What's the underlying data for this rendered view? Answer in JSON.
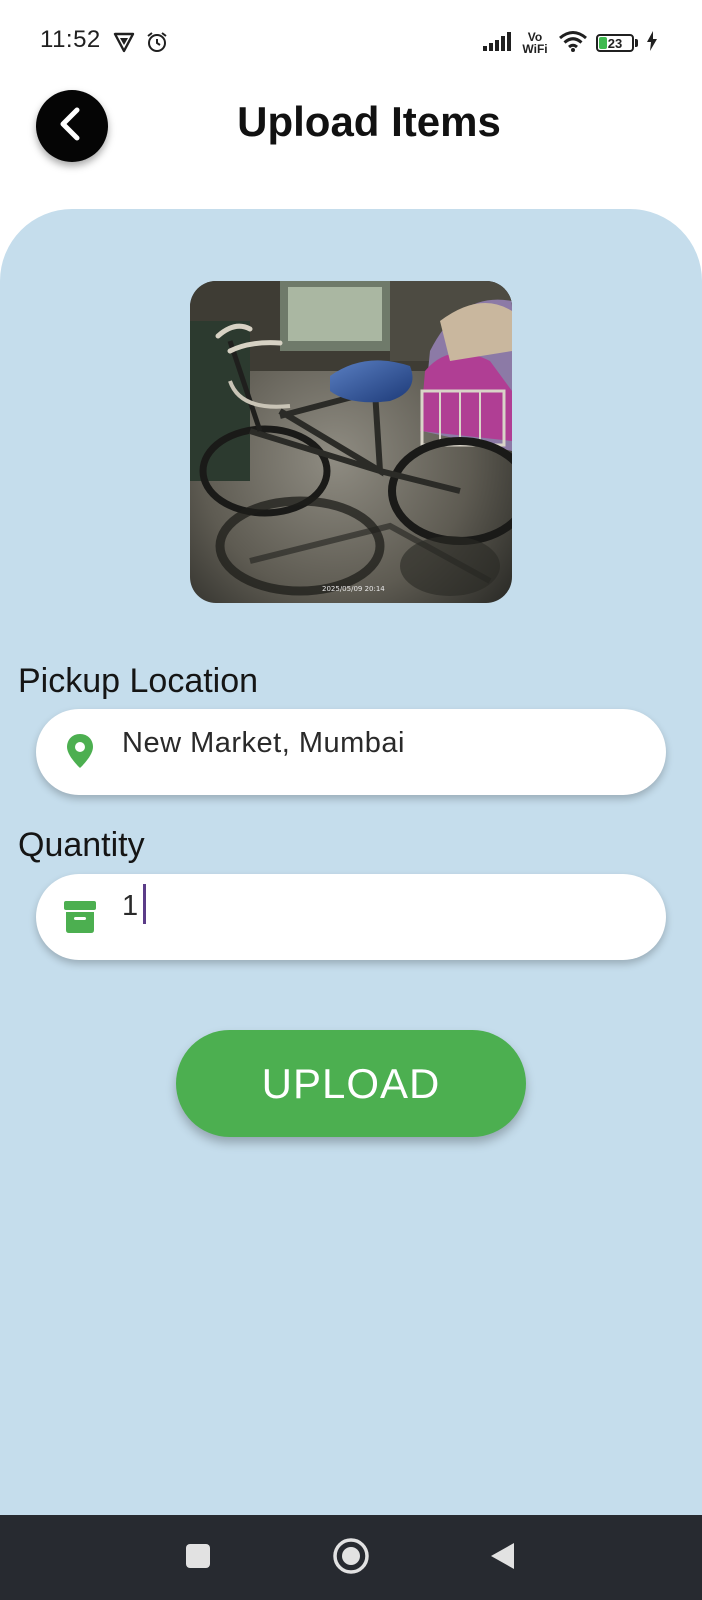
{
  "status_bar": {
    "time": "11:52",
    "network": "Vo WiFi",
    "battery_percent": "23",
    "battery_level": 0.23,
    "charging": true,
    "icons": [
      "vpn-icon",
      "alarm-icon",
      "signal-icon",
      "wifi-icon",
      "battery-icon",
      "charging-icon"
    ]
  },
  "header": {
    "title": "Upload Items",
    "back_icon": "chevron-left-icon"
  },
  "photo": {
    "timestamp": "2025/05/09 20:14",
    "subject": "bicycle"
  },
  "form": {
    "pickup": {
      "label": "Pickup Location",
      "value": "New Market, Mumbai",
      "icon": "location-pin-icon"
    },
    "quantity": {
      "label": "Quantity",
      "value": "1",
      "icon": "archive-box-icon"
    },
    "submit_label": "UPLOAD"
  },
  "nav_bar": {
    "buttons": [
      "recents-button",
      "home-button",
      "back-button"
    ]
  },
  "colors": {
    "card_background": "#c5ddec",
    "accent_green": "#4caf50",
    "nav_background": "#272a30",
    "caret": "#5b3c88"
  }
}
